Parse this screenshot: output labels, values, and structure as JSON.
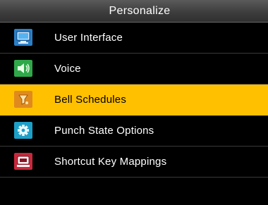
{
  "header": {
    "title": "Personalize"
  },
  "menu": {
    "items": [
      {
        "label": "User Interface",
        "icon": "monitor-icon"
      },
      {
        "label": "Voice",
        "icon": "speaker-icon"
      },
      {
        "label": "Bell Schedules",
        "icon": "bell-icon",
        "selected": true
      },
      {
        "label": "Punch State Options",
        "icon": "gear-icon"
      },
      {
        "label": "Shortcut Key Mappings",
        "icon": "keyboard-key-icon"
      }
    ]
  },
  "colors": {
    "selected_background": "#ffc000",
    "background": "#000000",
    "text": "#ffffff"
  }
}
